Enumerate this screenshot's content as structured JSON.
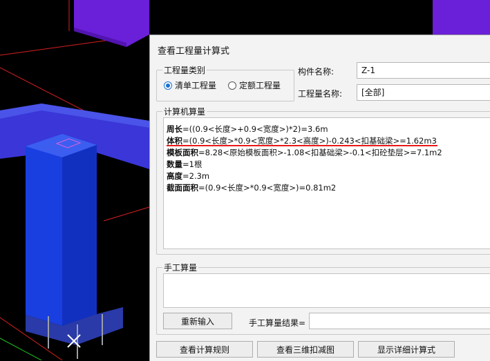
{
  "dialog": {
    "title": "查看工程量计算式",
    "category_group": "工程量类别",
    "radio_list": "清单工程量",
    "radio_quota": "定额工程量",
    "component_name_label": "构件名称:",
    "component_name_value": "Z-1",
    "quantity_name_label": "工程量名称:",
    "quantity_name_value": "[全部]",
    "computed_group": "计算机算量",
    "formulas": [
      {
        "name": "周长",
        "expr": "=((0.9<长度>+0.9<宽度>)*2)=3.6m"
      },
      {
        "name": "体积",
        "expr": "=(0.9<长度>*0.9<宽度>*2.3<高度>)-0.243<扣基础梁>=1.62m3"
      },
      {
        "name": "模板面积",
        "expr": "=8.28<原始模板面积>-1.08<扣基础梁>-0.1<扣砼垫层>=7.1m2"
      },
      {
        "name": "数量",
        "expr": "=1根"
      },
      {
        "name": "高度",
        "expr": "=2.3m"
      },
      {
        "name": "截面面积",
        "expr": "=(0.9<长度>*0.9<宽度>)=0.81m2"
      }
    ],
    "manual_group": "手工算量",
    "reenter_button": "重新输入",
    "manual_result_label": "手工算量结果=",
    "rules_button": "查看计算规则",
    "deduct_3d_button": "查看三维扣减图",
    "detail_button": "显示详细计算式"
  },
  "colors": {
    "column_blue": "#1a3fe0",
    "beam_purple": "#6a1fd8",
    "radio_accent": "#1a6fd1",
    "underline_red": "#e81818"
  }
}
